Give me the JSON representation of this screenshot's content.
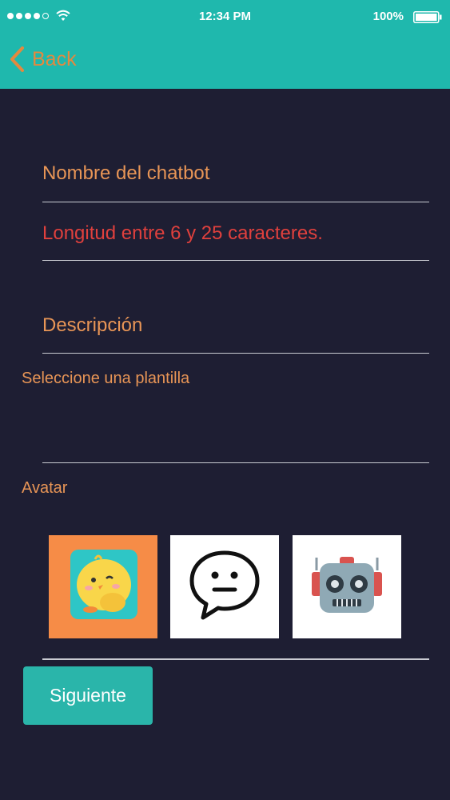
{
  "status_bar": {
    "time": "12:34 PM",
    "battery": "100%"
  },
  "nav": {
    "back_label": "Back"
  },
  "form": {
    "name_placeholder": "Nombre del chatbot",
    "name_error": "Longitud entre 6 y 25 caracteres.",
    "description_placeholder": "Descripción",
    "template_label": "Seleccione una plantilla",
    "avatar_label": "Avatar",
    "avatars": [
      {
        "icon": "chick-avatar-icon",
        "selected": true
      },
      {
        "icon": "speech-bubble-face-icon",
        "selected": false
      },
      {
        "icon": "robot-head-icon",
        "selected": false
      }
    ],
    "next_label": "Siguiente"
  },
  "colors": {
    "header": "#1fb8ad",
    "background": "#1e1e33",
    "accent_orange": "#e89556",
    "error_red": "#e0403d",
    "button": "#2ab5aa"
  }
}
